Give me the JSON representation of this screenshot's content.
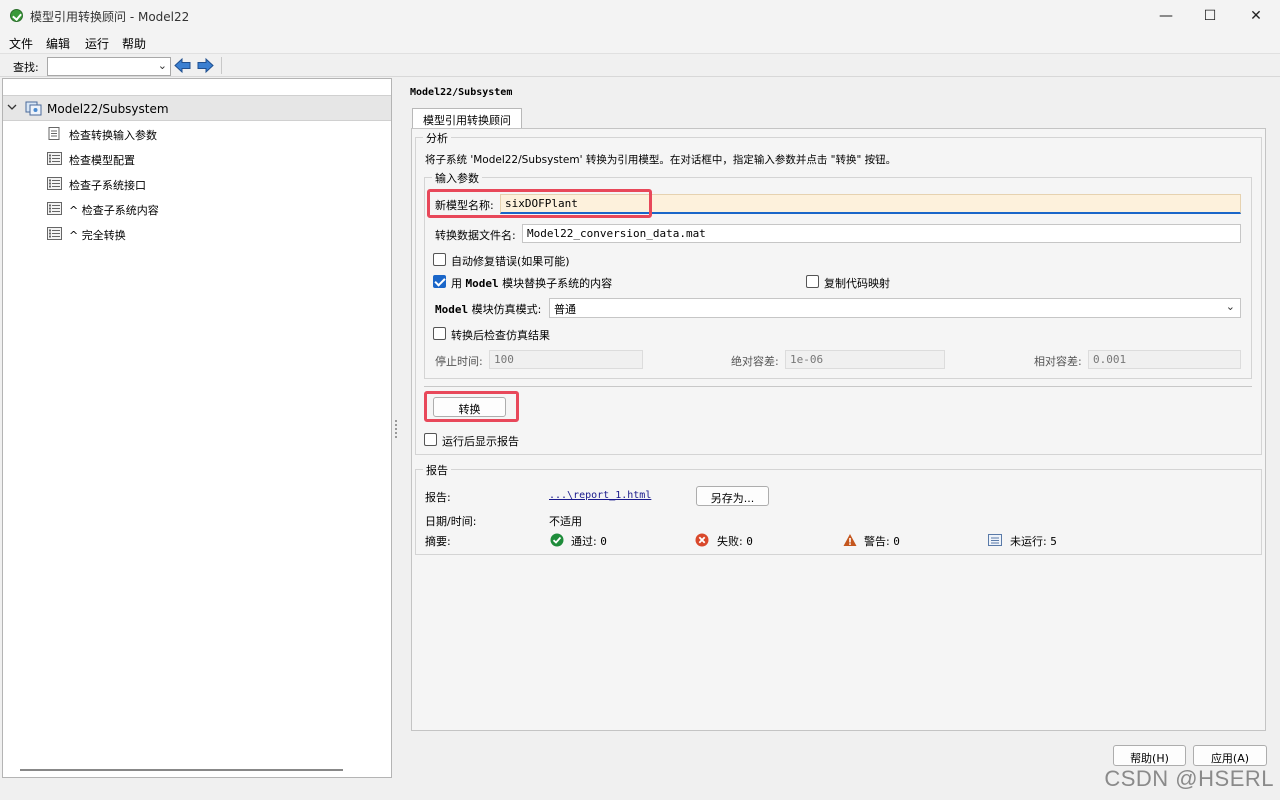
{
  "window": {
    "title": "模型引用转换顾问 - Model22",
    "minimize_glyph": "—",
    "maximize_glyph": "☐",
    "close_glyph": "✕"
  },
  "menu": {
    "file": "文件",
    "edit": "编辑",
    "run": "运行",
    "help": "帮助"
  },
  "toolbar": {
    "find_label": "查找:",
    "find_value": "",
    "back_icon": "left-arrow-icon",
    "forward_icon": "right-arrow-icon"
  },
  "tree": {
    "root": "Model22/Subsystem",
    "items": [
      {
        "label": "检查转换输入参数",
        "icon": "document-icon"
      },
      {
        "label": "检查模型配置",
        "icon": "list-icon"
      },
      {
        "label": "检查子系统接口",
        "icon": "list-icon"
      },
      {
        "label": "^ 检查子系统内容",
        "icon": "list-icon"
      },
      {
        "label": "^ 完全转换",
        "icon": "list-icon"
      }
    ]
  },
  "main": {
    "path_title": "Model22/Subsystem",
    "tab": "模型引用转换顾问",
    "analysis": {
      "legend": "分析",
      "description": "将子系统 'Model22/Subsystem' 转换为引用模型。在对话框中，指定输入参数并点击 \"转换\" 按钮。"
    },
    "inputs": {
      "legend": "输入参数",
      "new_model_name_label": "新模型名称:",
      "new_model_name_value": "sixDOFPlant",
      "data_file_label": "转换数据文件名:",
      "data_file_value": "Model22_conversion_data.mat",
      "auto_fix_label": "自动修复错误(如果可能)",
      "auto_fix_checked": false,
      "replace_label_prefix": "用",
      "replace_label_model": "Model",
      "replace_label_suffix": "模块替换子系统的内容",
      "replace_checked": true,
      "copy_code_label": "复制代码映射",
      "copy_code_checked": false,
      "sim_mode_label_model": "Model",
      "sim_mode_label_suffix": "模块仿真模式:",
      "sim_mode_value": "普通",
      "check_results_label": "转换后检查仿真结果",
      "check_results_checked": false,
      "stop_time_label": "停止时间:",
      "stop_time_value": "100",
      "abs_tol_label": "绝对容差:",
      "abs_tol_value": "1e-06",
      "rel_tol_label": "相对容差:",
      "rel_tol_value": "0.001"
    },
    "convert_button": "转换",
    "show_report_label": "运行后显示报告",
    "show_report_checked": false
  },
  "report": {
    "legend": "报告",
    "report_label": "报告:",
    "report_link": "...\\report_1.html",
    "save_as_button": "另存为...",
    "datetime_label": "日期/时间:",
    "datetime_value": "不适用",
    "summary_label": "摘要:",
    "pass_label": "通过:",
    "pass_count": "0",
    "fail_label": "失败:",
    "fail_count": "0",
    "warn_label": "警告:",
    "warn_count": "0",
    "notrun_label": "未运行:",
    "notrun_count": "5"
  },
  "footer": {
    "help_button": "帮助(H)",
    "apply_button": "应用(A)"
  },
  "watermark": "CSDN @HSERL",
  "colors": {
    "highlight": "#e8485a",
    "checkbox_checked": "#1a66c9",
    "pass": "#1e8c3a",
    "fail": "#d9482b",
    "warn": "#c4561e"
  }
}
